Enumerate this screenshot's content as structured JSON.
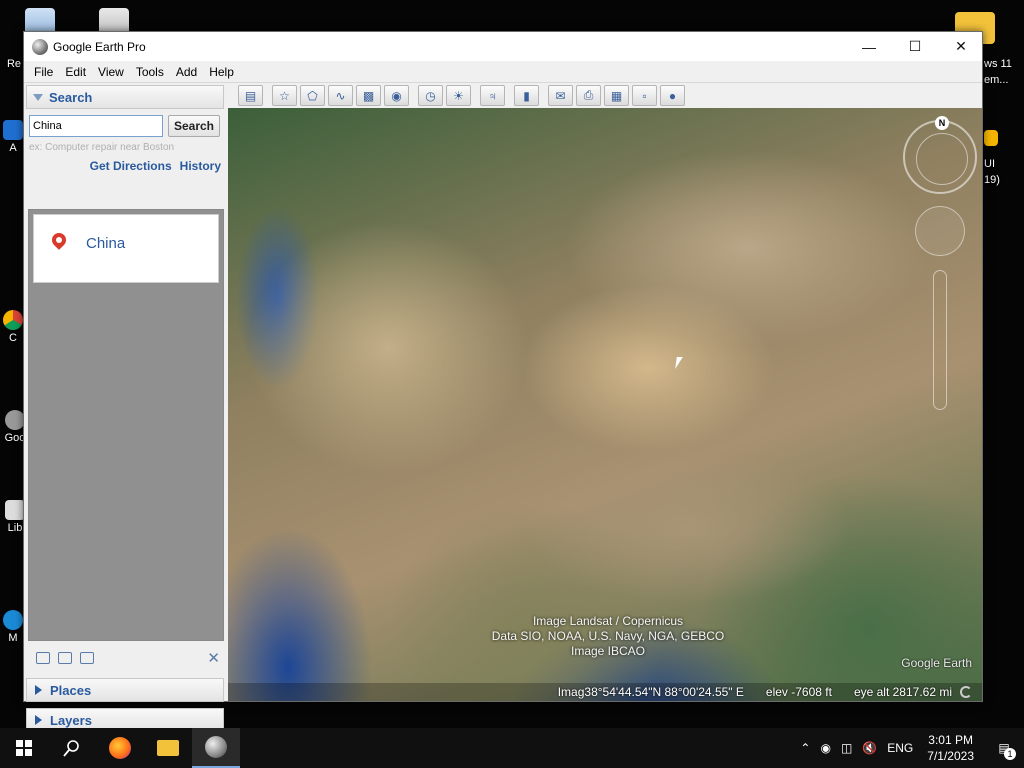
{
  "window": {
    "title": "Google Earth Pro"
  },
  "menu": [
    {
      "label": "File"
    },
    {
      "label": "Edit"
    },
    {
      "label": "View"
    },
    {
      "label": "Tools"
    },
    {
      "label": "Add"
    },
    {
      "label": "Help"
    }
  ],
  "search": {
    "header": "Search",
    "value": "China",
    "button": "Search",
    "hint": "ex: Computer repair near Boston",
    "get_directions": "Get Directions",
    "history": "History",
    "result": "China"
  },
  "panels": {
    "places": "Places",
    "layers": "Layers"
  },
  "map": {
    "credit_line1": "Image Landsat / Copernicus",
    "credit_line2": "Data SIO, NOAA, U.S. Navy, NGA, GEBCO",
    "credit_line3": "Image IBCAO",
    "logo": "Google Earth",
    "status_coords": "Imag38°54'44.54\"N 88°00'24.55\" E",
    "status_elev": "elev -7608 ft",
    "status_eye": "eye alt 2817.62 mi",
    "compass_label": "N"
  },
  "desktop_icons": [
    {
      "label": "Re"
    },
    {
      "label": "A"
    },
    {
      "label": "C"
    },
    {
      "label": "Goo"
    },
    {
      "label": "Lib"
    },
    {
      "label": "M"
    },
    {
      "label": "ws 11"
    },
    {
      "label": "em..."
    },
    {
      "label": "UI"
    },
    {
      "label": "19)"
    }
  ],
  "taskbar": {
    "lang": "ENG",
    "time": "3:01 PM",
    "date": "7/1/2023",
    "notif_count": "1"
  }
}
